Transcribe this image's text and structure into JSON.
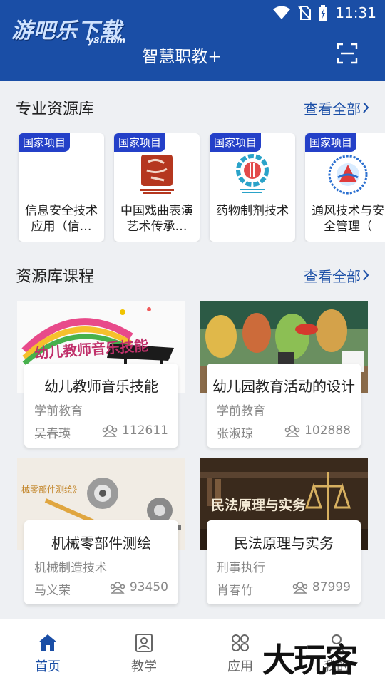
{
  "watermark": {
    "main": "游吧乐下载",
    "sub": "y8l.com"
  },
  "status": {
    "time": "11:31"
  },
  "header": {
    "title": "智慧职教+"
  },
  "resource_section": {
    "title": "专业资源库",
    "view_all": "查看全部",
    "items": [
      {
        "tag": "国家项目",
        "name": "信息安全技术应用（信…"
      },
      {
        "tag": "国家项目",
        "name": "中国戏曲表演艺术传承…"
      },
      {
        "tag": "国家项目",
        "name": "药物制剂技术"
      },
      {
        "tag": "国家项目",
        "name": "通风技术与安全管理（"
      }
    ]
  },
  "course_section": {
    "title": "资源库课程",
    "view_all": "查看全部",
    "courses": [
      {
        "title": "幼儿教师音乐技能",
        "category": "学前教育",
        "teacher": "吴春瑛",
        "views": "112611",
        "thumb_text": "幼儿教师音乐技能"
      },
      {
        "title": "幼儿园教育活动的设计",
        "category": "学前教育",
        "teacher": "张淑琼",
        "views": "102888",
        "thumb_text": ""
      },
      {
        "title": "机械零部件测绘",
        "category": "机械制造技术",
        "teacher": "马义荣",
        "views": "93450",
        "thumb_text": "械零部件测绘》"
      },
      {
        "title": "民法原理与实务",
        "category": "刑事执行",
        "teacher": "肖春竹",
        "views": "87999",
        "thumb_text": "民法原理与实务"
      }
    ]
  },
  "tabs": [
    {
      "label": "首页",
      "icon": "home-icon",
      "active": true
    },
    {
      "label": "教学",
      "icon": "teach-icon",
      "active": false
    },
    {
      "label": "应用",
      "icon": "apps-icon",
      "active": false
    },
    {
      "label": "我的",
      "icon": "profile-icon",
      "active": false
    }
  ],
  "brand_overlay": "大玩客",
  "colors": {
    "primary": "#1a4ea6",
    "tag": "#2440c8",
    "background": "#eef0f3"
  }
}
